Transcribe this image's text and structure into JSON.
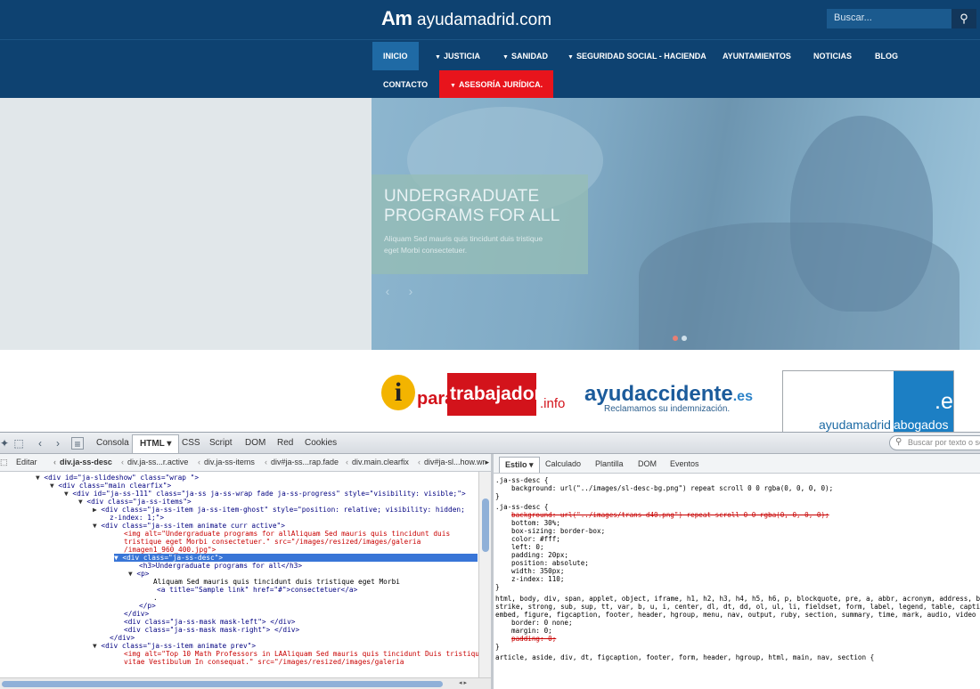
{
  "site": {
    "logo_mark": "Am",
    "logo_text": "ayudamadrid.com",
    "search_placeholder": "Buscar...",
    "nav": [
      {
        "label": "INICIO",
        "caret": false
      },
      {
        "label": "JUSTICIA",
        "caret": true
      },
      {
        "label": "SANIDAD",
        "caret": true
      },
      {
        "label": "SEGURIDAD SOCIAL - HACIENDA",
        "caret": true
      },
      {
        "label": "AYUNTAMIENTOS",
        "caret": false
      },
      {
        "label": "NOTICIAS",
        "caret": false
      },
      {
        "label": "BLOG",
        "caret": false
      },
      {
        "label": "CONTACTO",
        "caret": false
      },
      {
        "label": "ASESORÍA JURÍDICA.",
        "caret": true
      }
    ]
  },
  "hero": {
    "title_line1": "UNDERGRADUATE",
    "title_line2": "PROGRAMS FOR ALL",
    "text_line1": "Aliquam Sed mauris quis tincidunt duis tristique",
    "text_line2": "eget Morbi consectetuer."
  },
  "partners": {
    "p1_i": "i",
    "p1_para": "para",
    "p1_trab": "trabajadores",
    "p1_info": ".info",
    "p2_name": "ayudaccidente",
    "p2_tld": ".es",
    "p2_slogan": "Reclamamos su indemnización.",
    "p3_tld": ".es",
    "p3_name": "ayudamadrid",
    "p3_sub": "abogados"
  },
  "devtools": {
    "tabs": [
      "Consola",
      "HTML",
      "CSS",
      "Script",
      "DOM",
      "Red",
      "Cookies"
    ],
    "selected_tab": "HTML",
    "search_placeholder": "Buscar por texto o sele",
    "edit_label": "Editar",
    "breadcrumbs": [
      "div.ja-ss-desc",
      "div.ja-ss...r.active",
      "div.ja-ss-items",
      "div#ja-ss...rap.fade",
      "div.main.clearfix",
      "div#ja-sl...how.wr"
    ],
    "side_tabs": [
      "Estilo",
      "Calculado",
      "Plantilla",
      "DOM",
      "Eventos"
    ],
    "html_lines": [
      "<div id=\"ja-slideshow\" class=\"wrap \">",
      "<div class=\"main clearfix\">",
      "<div id=\"ja-ss-111\" class=\"ja-ss ja-ss-wrap fade ja-ss-progress\" style=\"visibility: visible;\">",
      "<div class=\"ja-ss-items\">",
      "<div class=\"ja-ss-item ja-ss-item-ghost\" style=\"position: relative; visibility: hidden;",
      "z-index: 1;\">",
      "<div class=\"ja-ss-item animate curr active\">",
      "<img alt=\"Undergraduate programs for allAliquam Sed mauris quis tincidunt duis",
      "tristique eget Morbi consectetuer.\" src=\"/images/resized/images/galeria",
      "/imagen1_960_400.jpg\">",
      "<div class=\"ja-ss-desc\">",
      "<h3>Undergraduate programs for all</h3>",
      "<p>",
      "Aliquam Sed mauris quis tincidunt duis tristique eget Morbi",
      "<a title=\"Sample link\" href=\"#\">consectetuer</a>",
      ".",
      "</p>",
      "</div>",
      "<div class=\"ja-ss-mask mask-left\"> </div>",
      "<div class=\"ja-ss-mask mask-right\"> </div>",
      "</div>",
      "<div class=\"ja-ss-item animate prev\">",
      "<img alt=\"Top 10 Math Professors in LAAliquam Sed mauris quis tincidunt Duis tristique",
      "vitae Vestibulum In consequat.\" src=\"/images/resized/images/galeria"
    ],
    "css_lines": [
      ".ja-ss-desc {",
      "background: url(\"../images/sl-desc-bg.png\") repeat scroll 0 0 rgba(0, 0, 0, 0);",
      "}",
      ".ja-ss-desc {",
      "background: url(\"../images/trans-d40.png\") repeat scroll 0 0 rgba(0, 0, 0, 0);",
      "bottom: 30%;",
      "box-sizing: border-box;",
      "color: #fff;",
      "left: 0;",
      "padding: 20px;",
      "position: absolute;",
      "width: 350px;",
      "z-index: 110;",
      "}",
      "html, body, div, span, applet, object, iframe, h1, h2, h3, h4, h5, h6, p, blockquote, pre, a, abbr, acronym, address, b",
      "strike, strong, sub, sup, tt, var, b, u, i, center, dl, dt, dd, ol, ul, li, fieldset, form, label, legend, table, capti",
      "embed, figure, figcaption, footer, header, hgroup, menu, nav, output, ruby, section, summary, time, mark, audio, video",
      "border: 0 none;",
      "margin: 0;",
      "padding: 0;",
      "}",
      "article, aside, div, dt, figcaption, footer, form, header, hgroup, html, main, nav, section {"
    ]
  }
}
